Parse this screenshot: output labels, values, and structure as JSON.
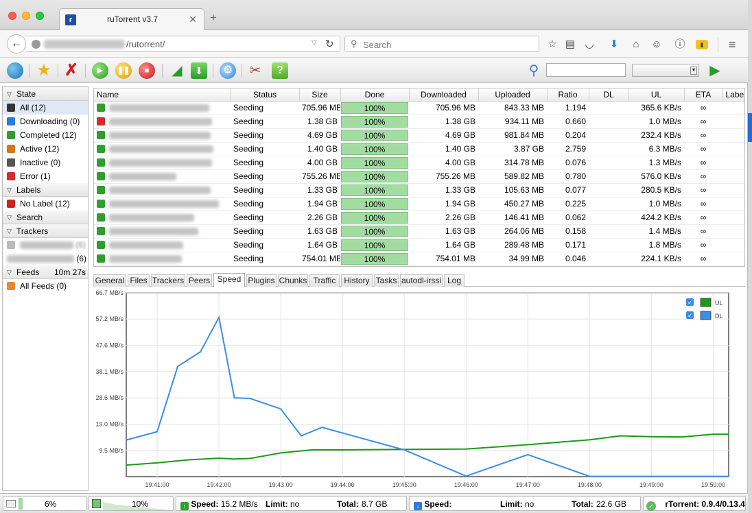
{
  "browser": {
    "tab_title": "ruTorrent v3.7",
    "url_path": "/rutorrent/",
    "search_placeholder": "Search"
  },
  "toolbar": {
    "filter_value": ""
  },
  "sidebar": {
    "state_header": "State",
    "states": [
      {
        "label": "All (12)",
        "icon": "all-icon",
        "color": "#333333"
      },
      {
        "label": "Downloading (0)",
        "icon": "download-arrow-icon",
        "color": "#2a7be0"
      },
      {
        "label": "Completed (12)",
        "icon": "completed-up-arrow-icon",
        "color": "#2f9e2f"
      },
      {
        "label": "Active (12)",
        "icon": "active-icon",
        "color": "#d07a18"
      },
      {
        "label": "Inactive (0)",
        "icon": "inactive-icon",
        "color": "#555555"
      },
      {
        "label": "Error (1)",
        "icon": "error-x-icon",
        "color": "#d22c2c"
      }
    ],
    "labels_header": "Labels",
    "labels": [
      {
        "label": "No Label (12)",
        "icon": "no-label-icon",
        "color": "#cc2222"
      }
    ],
    "search_header": "Search",
    "trackers_header": "Trackers",
    "trackers": [
      {
        "count": "(6)"
      },
      {
        "count": "(6)"
      }
    ],
    "feeds_header": "Feeds",
    "feeds_timer": "10m 27s",
    "feeds": [
      {
        "label": "All Feeds (0)",
        "icon": "rss-icon",
        "color": "#e8892d"
      }
    ]
  },
  "table": {
    "columns": [
      "Name",
      "Status",
      "Size",
      "Done",
      "Downloaded",
      "Uploaded",
      "Ratio",
      "DL",
      "UL",
      "ETA",
      "Label"
    ],
    "rows": [
      {
        "status": "Seeding",
        "size": "705.96 MB",
        "done": "100%",
        "downloaded": "705.96 MB",
        "uploaded": "843.33 MB",
        "ratio": "1.194",
        "dl": "",
        "ul": "365.6 KB/s",
        "eta": "∞",
        "label": "",
        "error": false
      },
      {
        "status": "Seeding",
        "size": "1.38 GB",
        "done": "100%",
        "downloaded": "1.38 GB",
        "uploaded": "934.11 MB",
        "ratio": "0.660",
        "dl": "",
        "ul": "1.0 MB/s",
        "eta": "∞",
        "label": "",
        "error": true
      },
      {
        "status": "Seeding",
        "size": "4.69 GB",
        "done": "100%",
        "downloaded": "4.69 GB",
        "uploaded": "981.84 MB",
        "ratio": "0.204",
        "dl": "",
        "ul": "232.4 KB/s",
        "eta": "∞",
        "label": "",
        "error": false
      },
      {
        "status": "Seeding",
        "size": "1.40 GB",
        "done": "100%",
        "downloaded": "1.40 GB",
        "uploaded": "3.87 GB",
        "ratio": "2.759",
        "dl": "",
        "ul": "6.3 MB/s",
        "eta": "∞",
        "label": "",
        "error": false
      },
      {
        "status": "Seeding",
        "size": "4.00 GB",
        "done": "100%",
        "downloaded": "4.00 GB",
        "uploaded": "314.78 MB",
        "ratio": "0.076",
        "dl": "",
        "ul": "1.3 MB/s",
        "eta": "∞",
        "label": "",
        "error": false
      },
      {
        "status": "Seeding",
        "size": "755.26 MB",
        "done": "100%",
        "downloaded": "755.26 MB",
        "uploaded": "589.82 MB",
        "ratio": "0.780",
        "dl": "",
        "ul": "576.0 KB/s",
        "eta": "∞",
        "label": "",
        "error": false
      },
      {
        "status": "Seeding",
        "size": "1.33 GB",
        "done": "100%",
        "downloaded": "1.33 GB",
        "uploaded": "105.63 MB",
        "ratio": "0.077",
        "dl": "",
        "ul": "280.5 KB/s",
        "eta": "∞",
        "label": "",
        "error": false
      },
      {
        "status": "Seeding",
        "size": "1.94 GB",
        "done": "100%",
        "downloaded": "1.94 GB",
        "uploaded": "450.27 MB",
        "ratio": "0.225",
        "dl": "",
        "ul": "1.0 MB/s",
        "eta": "∞",
        "label": "",
        "error": false
      },
      {
        "status": "Seeding",
        "size": "2.26 GB",
        "done": "100%",
        "downloaded": "2.26 GB",
        "uploaded": "146.41 MB",
        "ratio": "0.062",
        "dl": "",
        "ul": "424.2 KB/s",
        "eta": "∞",
        "label": "",
        "error": false
      },
      {
        "status": "Seeding",
        "size": "1.63 GB",
        "done": "100%",
        "downloaded": "1.63 GB",
        "uploaded": "264.06 MB",
        "ratio": "0.158",
        "dl": "",
        "ul": "1.4 MB/s",
        "eta": "∞",
        "label": "",
        "error": false
      },
      {
        "status": "Seeding",
        "size": "1.64 GB",
        "done": "100%",
        "downloaded": "1.64 GB",
        "uploaded": "289.48 MB",
        "ratio": "0.171",
        "dl": "",
        "ul": "1.8 MB/s",
        "eta": "∞",
        "label": "",
        "error": false
      },
      {
        "status": "Seeding",
        "size": "754.01 MB",
        "done": "100%",
        "downloaded": "754.01 MB",
        "uploaded": "34.99 MB",
        "ratio": "0.046",
        "dl": "",
        "ul": "224.1 KB/s",
        "eta": "∞",
        "label": "",
        "error": false
      }
    ]
  },
  "detail_tabs": [
    "General",
    "Files",
    "Trackers",
    "Peers",
    "Speed",
    "Plugins",
    "Chunks",
    "Traffic",
    "History",
    "Tasks",
    "autodl-irssi",
    "Log"
  ],
  "active_tab": "Speed",
  "chart_data": {
    "type": "line",
    "ylim": [
      0,
      66.7
    ],
    "yticks": [
      "66.7 MB/s",
      "57.2 MB/s",
      "47.6 MB/s",
      "38.1 MB/s",
      "28.6 MB/s",
      "19.0 MB/s",
      "9.5 MB/s"
    ],
    "ytick_values": [
      66.7,
      57.2,
      47.6,
      38.1,
      28.6,
      19.0,
      9.5
    ],
    "xlim": [
      "19:40:30",
      "19:50:15"
    ],
    "xticks": [
      "19:41:00",
      "19:42:00",
      "19:43:00",
      "19:44:00",
      "19:45:00",
      "19:46:00",
      "19:47:00",
      "19:48:00",
      "19:49:00",
      "19:50:00"
    ],
    "grid": true,
    "legend_position": "top-right",
    "series": [
      {
        "name": "UL",
        "color": "#1a9a1a",
        "checked": true,
        "points": [
          [
            "19:40:30",
            4.2
          ],
          [
            "19:41:00",
            5.0
          ],
          [
            "19:41:30",
            6.1
          ],
          [
            "19:42:00",
            6.7
          ],
          [
            "19:42:15",
            6.4
          ],
          [
            "19:42:30",
            6.6
          ],
          [
            "19:43:00",
            8.6
          ],
          [
            "19:43:30",
            9.7
          ],
          [
            "19:44:00",
            9.7
          ],
          [
            "19:45:00",
            9.9
          ],
          [
            "19:46:00",
            10.0
          ],
          [
            "19:47:00",
            11.6
          ],
          [
            "19:48:00",
            13.4
          ],
          [
            "19:48:30",
            14.8
          ],
          [
            "19:49:00",
            14.5
          ],
          [
            "19:49:30",
            14.4
          ],
          [
            "19:50:00",
            15.4
          ],
          [
            "19:50:15",
            15.4
          ]
        ]
      },
      {
        "name": "DL",
        "color": "#3a8ee6",
        "checked": true,
        "points": [
          [
            "19:40:30",
            13.3
          ],
          [
            "19:41:00",
            16.3
          ],
          [
            "19:41:20",
            40.0
          ],
          [
            "19:41:42",
            45.3
          ],
          [
            "19:42:00",
            57.8
          ],
          [
            "19:42:15",
            28.6
          ],
          [
            "19:42:30",
            28.4
          ],
          [
            "19:43:00",
            24.6
          ],
          [
            "19:43:20",
            14.8
          ],
          [
            "19:43:40",
            17.9
          ],
          [
            "19:45:00",
            9.7
          ],
          [
            "19:46:00",
            0.2
          ],
          [
            "19:47:00",
            8.0
          ],
          [
            "19:48:00",
            0.1
          ],
          [
            "19:50:15",
            0.1
          ]
        ]
      }
    ]
  },
  "status": {
    "disk_pct": "6%",
    "cpu_pct": "10%",
    "ul_speed_label": "Speed:",
    "ul_speed": "15.2 MB/s",
    "ul_limit_label": "Limit:",
    "ul_limit": "no",
    "ul_total_label": "Total:",
    "ul_total": "8.7 GB",
    "dl_speed_label": "Speed:",
    "dl_limit_label": "Limit:",
    "dl_limit": "no",
    "dl_total_label": "Total:",
    "dl_total": "22.6 GB",
    "version": "rTorrent: 0.9.4/0.13.4"
  }
}
